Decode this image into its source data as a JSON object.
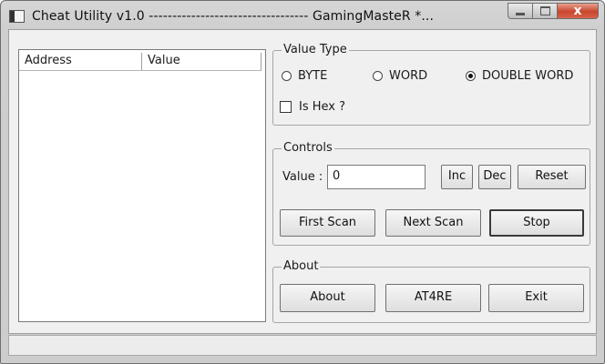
{
  "window": {
    "title": "Cheat Utility v1.0 ---------------------------------- GamingMasteR *...",
    "controls": {
      "minimize": "minimize-icon",
      "maximize": "maximize-icon",
      "close_label": "x"
    }
  },
  "list": {
    "columns": [
      "Address",
      "Value"
    ]
  },
  "value_type": {
    "legend": "Value Type",
    "options": [
      {
        "label": "BYTE",
        "selected": false
      },
      {
        "label": "WORD",
        "selected": false
      },
      {
        "label": "DOUBLE WORD",
        "selected": true
      }
    ],
    "is_hex_label": "Is Hex ?",
    "is_hex_checked": false
  },
  "controls_group": {
    "legend": "Controls",
    "value_label": "Value :",
    "value": "0",
    "inc_label": "Inc",
    "dec_label": "Dec",
    "reset_label": "Reset",
    "first_scan_label": "First Scan",
    "next_scan_label": "Next Scan",
    "stop_label": "Stop"
  },
  "about_group": {
    "legend": "About",
    "about_label": "About",
    "at4re_label": "AT4RE",
    "exit_label": "Exit"
  },
  "status": {
    "text": ""
  }
}
